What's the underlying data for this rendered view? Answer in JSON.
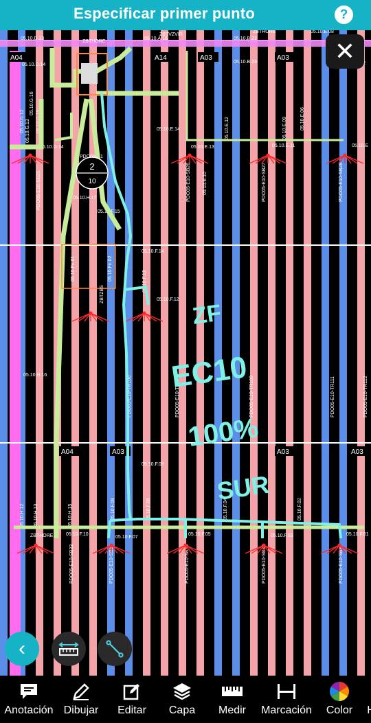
{
  "header": {
    "title": "Especificar primer punto",
    "help_symbol": "?"
  },
  "close_symbol": "✕",
  "back_symbol": "‹",
  "toolbar": {
    "items": [
      {
        "label": "Anotación",
        "icon": "annotation-icon"
      },
      {
        "label": "Dibujar",
        "icon": "pencil-icon"
      },
      {
        "label": "Editar",
        "icon": "edit-icon"
      },
      {
        "label": "Capa",
        "icon": "layers-icon"
      },
      {
        "label": "Medir",
        "icon": "ruler-icon"
      },
      {
        "label": "Marcación",
        "icon": "dimension-icon"
      },
      {
        "label": "Color",
        "icon": "color-wheel-icon"
      },
      {
        "label": "H",
        "icon": "more-icon"
      }
    ]
  },
  "drawing": {
    "zone_labels": [
      "A04",
      "A14",
      "A03",
      "A03",
      "A04",
      "A03",
      "A03",
      "A03"
    ],
    "labels_top": [
      "05.10.D.13",
      "ZBTHORE",
      "05.10.A.16",
      "ZBTVZVIR",
      "05.10.B.22",
      "ZBTHORE",
      "05.10.E.08",
      "05.10.D.14",
      "05.10.B.23",
      "05.10.E.2"
    ],
    "labels_rows_top": [
      "05.10.G.14",
      "05.10.E.13",
      "05.10.E.11",
      "05.10.E",
      "05.10.E.14",
      "05.10.H.17",
      "05.10.F.15",
      "05.10.F.14",
      "05.10.F.12",
      "05.10.H.16",
      "PDO05-E1"
    ],
    "labels_vertical": [
      "05.10.G.16",
      "05.10.G.15",
      "05.10.G.12",
      "05.10.G.13",
      "05.10.E.12",
      "05.10.E.09",
      "05.10.E.10",
      "05.10.E.06",
      "PDO05-E10-SB25",
      "PDO05-E10-SB26",
      "PDO05-E10-SB27",
      "PDO05-E10-SB28",
      "PDO05-E10-TR106",
      "PDO05-E10-TR109",
      "PDO05-E10-TR110",
      "PDO05-E10-TR111",
      "PDO05-E10-TR112",
      "05.10.Fn.01",
      "05.10.Fn.02",
      "05.10.F.13",
      "ZBTZBS",
      "05.10.F.08",
      "05.10.F.04",
      "05.10.F.02",
      "05.10.F.06",
      "05.10.H.12",
      "05.10.H.13",
      "05.10.H.15",
      "PDO05-E10-SB33",
      "PDO05-E10-SB34",
      "PDO05-E10-SB35",
      "PDO05-E10-SB36",
      "PDO05-E10-SB37"
    ],
    "labels_bottom": [
      "ZBTHORE",
      "05.10.F.10",
      "05.10.F.07",
      "05.10.F.09",
      "05.10.F.05",
      "05.10.F.03",
      "05.10.F.01"
    ],
    "node_top": "2",
    "node_bottom": "10",
    "node_name": "PDO05-E10",
    "handwriting": [
      "ZF",
      "EC10",
      "100%",
      "SUR"
    ]
  }
}
